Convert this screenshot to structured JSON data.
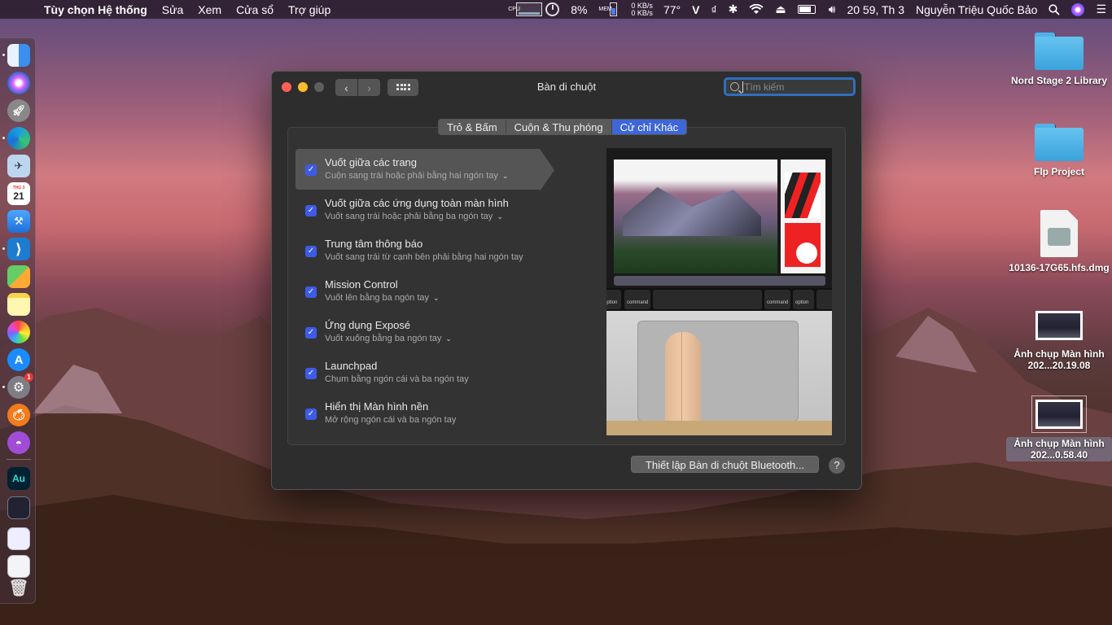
{
  "menubar": {
    "app_name": "Tùy chọn Hệ thống",
    "menus": [
      "Sửa",
      "Xem",
      "Cửa sổ",
      "Trợ giúp"
    ],
    "cpu_label": "CPU",
    "cpu_percent": "8%",
    "mem_label": "MEM",
    "net_up": "0 KB/s",
    "net_down": "0 KB/s",
    "temperature": "77°",
    "clock": "20 59, Th 3",
    "user": "Nguyễn Triệu Quốc Bảo"
  },
  "window": {
    "title": "Bàn di chuột",
    "search_placeholder": "Tìm kiếm",
    "tabs": [
      {
        "label": "Trỏ & Bấm",
        "active": false
      },
      {
        "label": "Cuộn & Thu phóng",
        "active": false
      },
      {
        "label": "Cử chỉ Khác",
        "active": true
      }
    ],
    "gestures": [
      {
        "title": "Vuốt giữa các trang",
        "subtitle": "Cuộn sang trái hoặc phải bằng hai ngón tay",
        "checked": true,
        "has_menu": true,
        "selected": true
      },
      {
        "title": "Vuốt giữa các ứng dụng toàn màn hình",
        "subtitle": "Vuốt sang trái hoặc phải bằng ba ngón tay",
        "checked": true,
        "has_menu": true,
        "selected": false
      },
      {
        "title": "Trung tâm thông báo",
        "subtitle": "Vuốt sang trái từ cạnh bên phải bằng hai ngón tay",
        "checked": true,
        "has_menu": false,
        "selected": false
      },
      {
        "title": "Mission Control",
        "subtitle": "Vuốt lên bằng ba ngón tay",
        "checked": true,
        "has_menu": true,
        "selected": false
      },
      {
        "title": "Ứng dụng Exposé",
        "subtitle": "Vuốt xuống bằng ba ngón tay",
        "checked": true,
        "has_menu": true,
        "selected": false
      },
      {
        "title": "Launchpad",
        "subtitle": "Chụm bằng ngón cái và ba ngón tay",
        "checked": true,
        "has_menu": false,
        "selected": false
      },
      {
        "title": "Hiển thị Màn hình nền",
        "subtitle": "Mở rộng ngón cái và ba ngón tay",
        "checked": true,
        "has_menu": false,
        "selected": false
      }
    ],
    "preview_keys": {
      "option_left": "option",
      "command_left": "command",
      "command_right": "command",
      "option_right": "option"
    },
    "bluetooth_button": "Thiết lập Bàn di chuột Bluetooth...",
    "help_button": "?"
  },
  "desktop": {
    "items": [
      {
        "label": "Nord Stage 2 Library",
        "kind": "folder"
      },
      {
        "label": "Flp Project",
        "kind": "folder"
      },
      {
        "label": "10136-17G65.hfs.dmg",
        "kind": "dmg"
      },
      {
        "label": "Ảnh chụp Màn hình 202...20.19.08",
        "kind": "screenshot"
      },
      {
        "label": "Ảnh chụp Màn hình 202...0.58.40",
        "kind": "screenshot"
      }
    ]
  },
  "dock": {
    "calendar_day": "21",
    "settings_badge": "1",
    "audition_label": "Au"
  }
}
